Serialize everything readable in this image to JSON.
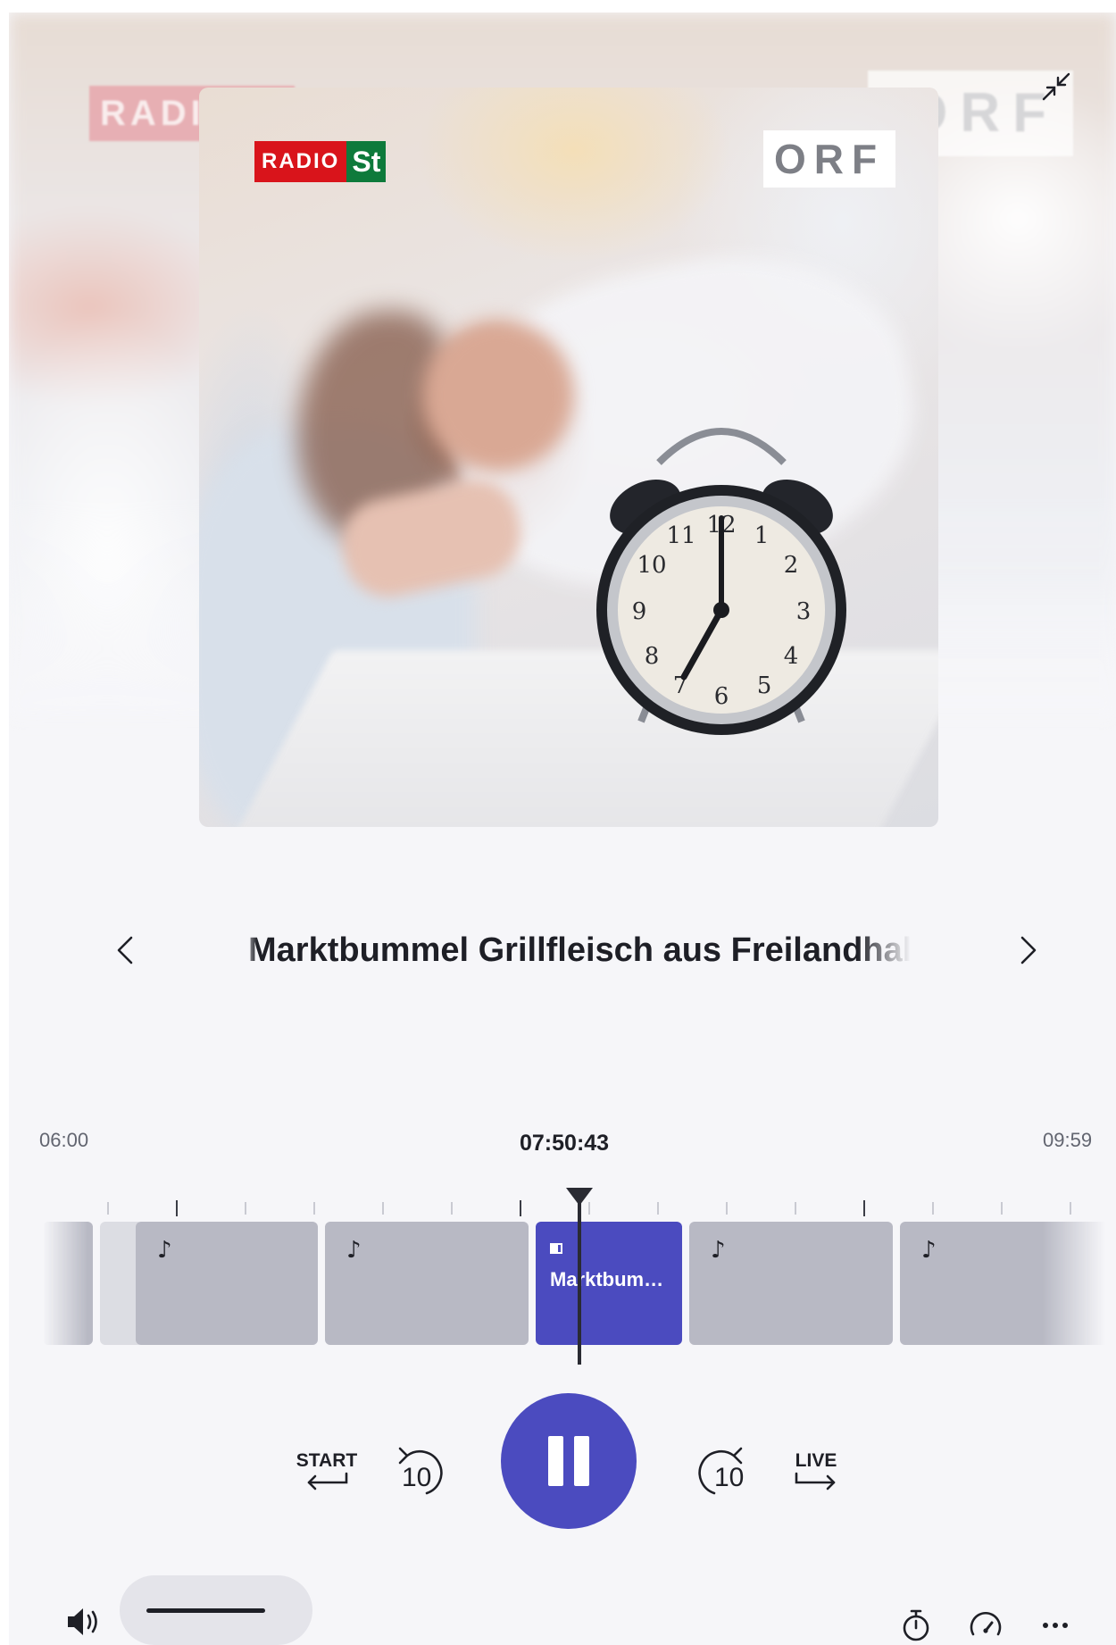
{
  "artwork": {
    "background_logo_left": "RADIO",
    "background_logo_right": "ORF",
    "logo_radio": "RADIO",
    "logo_station": "St",
    "logo_orf": "ORF"
  },
  "now_playing": {
    "title": "Marktbummel Grillfleisch aus Freilandhaltung"
  },
  "timeline": {
    "start_time": "06:00",
    "current_time": "07:50:43",
    "end_time": "09:59",
    "active_segment_label": "Marktbum…",
    "segment_note_icon": "♪"
  },
  "controls": {
    "start_label": "START",
    "rewind_seconds": "10",
    "forward_seconds": "10",
    "live_label": "LIVE",
    "play_state": "playing"
  },
  "volume": {
    "level": 0.85
  },
  "icons": {
    "minimize": "minimize-icon",
    "prev": "chevron-left-icon",
    "next": "chevron-right-icon",
    "volume": "speaker-icon",
    "sleep_timer": "stopwatch-icon",
    "speed": "speedometer-icon",
    "more": "more-icon"
  },
  "colors": {
    "accent": "#4b4bbf",
    "segment": "#b8b9c4",
    "background": "#f6f6f9",
    "radio_red": "#d9141b",
    "station_green": "#0e7a3b"
  }
}
